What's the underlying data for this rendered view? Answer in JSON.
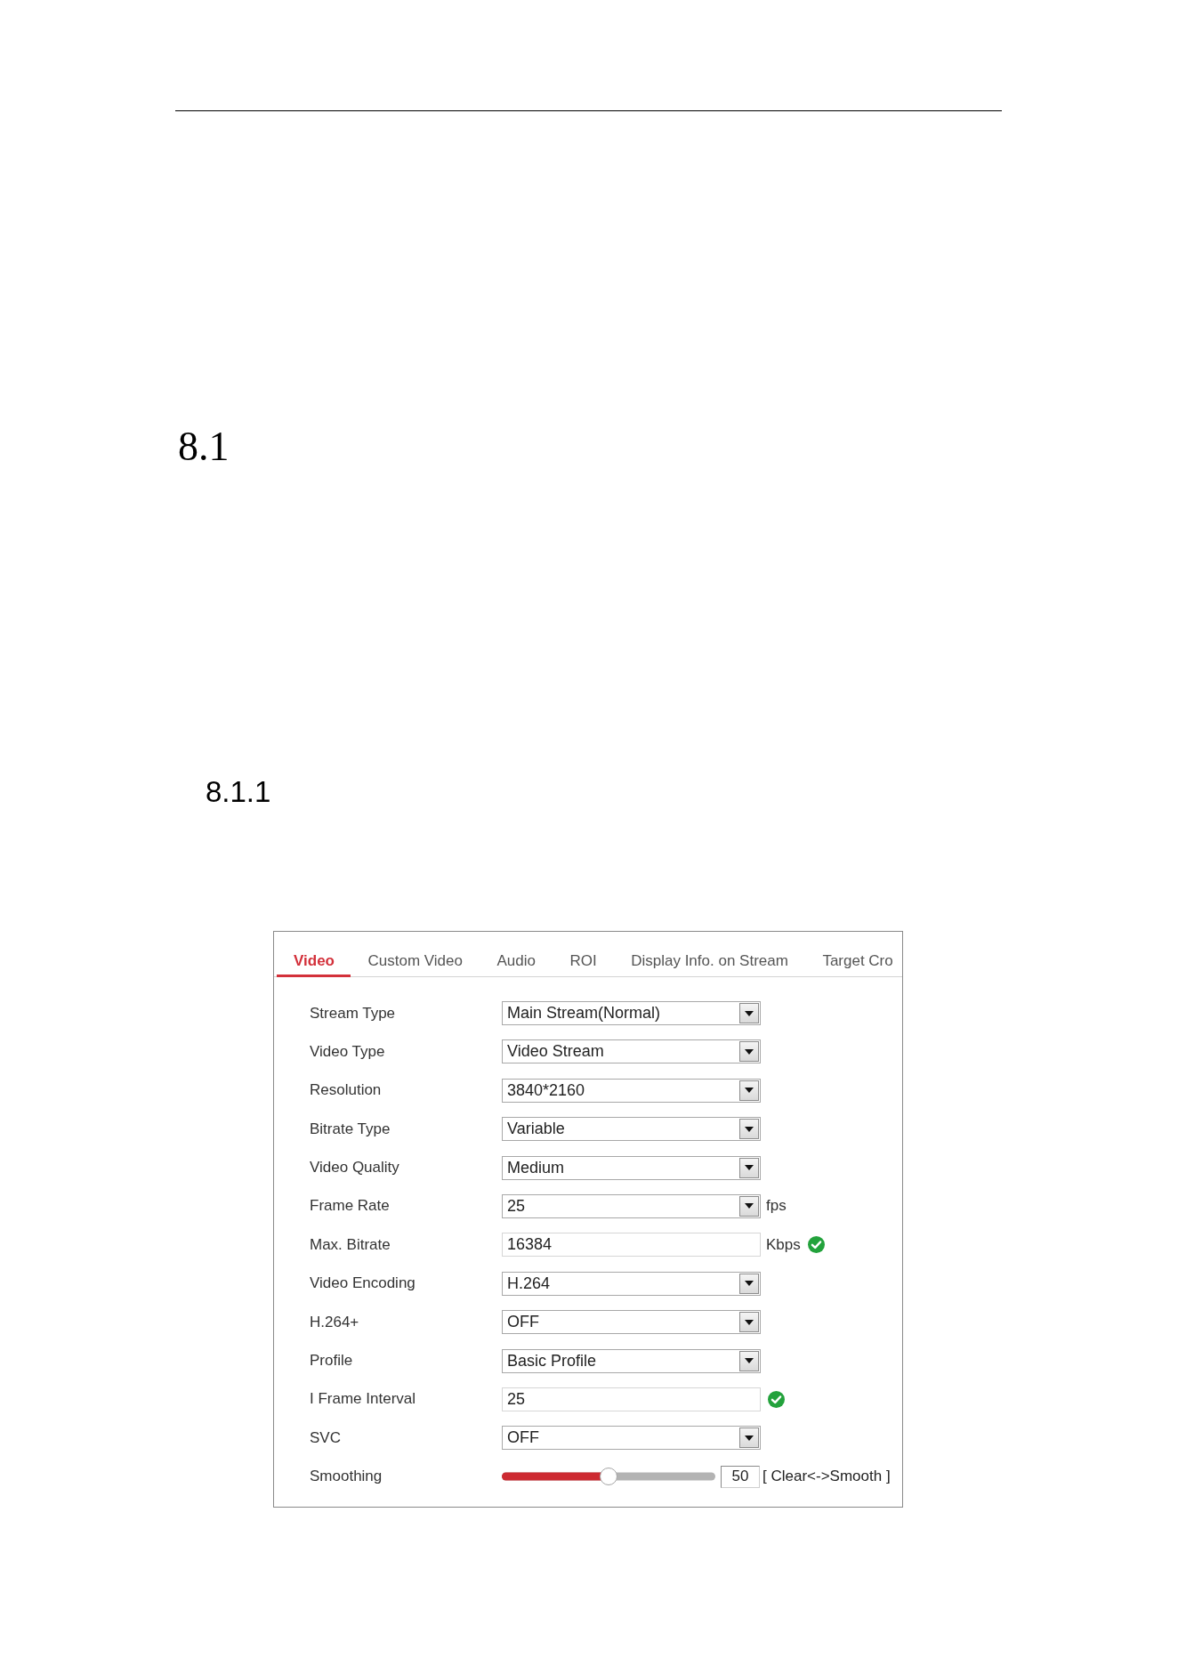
{
  "section": {
    "number": "8.1"
  },
  "subsection": {
    "number": "8.1.1"
  },
  "settings_panel": {
    "tabs": [
      {
        "label": "Video",
        "selected": true
      },
      {
        "label": "Custom Video",
        "selected": false
      },
      {
        "label": "Audio",
        "selected": false
      },
      {
        "label": "ROI",
        "selected": false
      },
      {
        "label": "Display Info. on Stream",
        "selected": false
      },
      {
        "label": "Target Cro",
        "selected": false
      }
    ],
    "fields": [
      {
        "label": "Stream Type",
        "kind": "select",
        "value": "Main Stream(Normal)"
      },
      {
        "label": "Video Type",
        "kind": "select",
        "value": "Video Stream"
      },
      {
        "label": "Resolution",
        "kind": "select",
        "value": "3840*2160"
      },
      {
        "label": "Bitrate Type",
        "kind": "select",
        "value": "Variable"
      },
      {
        "label": "Video Quality",
        "kind": "select",
        "value": "Medium"
      },
      {
        "label": "Frame Rate",
        "kind": "select",
        "value": "25",
        "unit": "fps"
      },
      {
        "label": "Max. Bitrate",
        "kind": "text",
        "value": "16384",
        "unit": "Kbps",
        "valid": true
      },
      {
        "label": "Video Encoding",
        "kind": "select",
        "value": "H.264"
      },
      {
        "label": "H.264+",
        "kind": "select",
        "value": "OFF"
      },
      {
        "label": "Profile",
        "kind": "select",
        "value": "Basic Profile"
      },
      {
        "label": "I Frame Interval",
        "kind": "text",
        "value": "25",
        "valid": true
      },
      {
        "label": "SVC",
        "kind": "select",
        "value": "OFF"
      },
      {
        "label": "Smoothing",
        "kind": "slider",
        "level": 0.5,
        "value": "50",
        "hint": "[ Clear<->Smooth ]"
      }
    ]
  }
}
